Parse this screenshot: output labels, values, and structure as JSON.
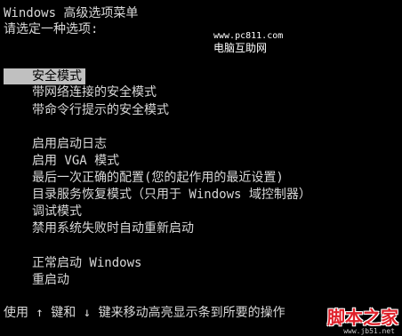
{
  "header": {
    "title": "Windows 高级选项菜单",
    "prompt": "请选定一种选项:"
  },
  "watermark": {
    "site": "www.pc811.com",
    "name": "电脑互助网"
  },
  "menu": {
    "selected_index": 0,
    "group1": [
      {
        "label": "安全模式"
      },
      {
        "label": "带网络连接的安全模式"
      },
      {
        "label": "带命令行提示的安全模式"
      }
    ],
    "group2": [
      {
        "label": "启用启动日志"
      },
      {
        "label": "启用 VGA 模式"
      },
      {
        "label": "最后一次正确的配置(您的起作用的最近设置)"
      },
      {
        "label": "目录服务恢复模式（只用于 Windows 域控制器）"
      },
      {
        "label": "调试模式"
      },
      {
        "label": "禁用系统失败时自动重新启动"
      }
    ],
    "group3": [
      {
        "label": "正常启动 Windows"
      },
      {
        "label": "重启动"
      }
    ]
  },
  "footer": {
    "instructions": "使用 ↑ 键和 ↓ 键来移动高亮显示条到所要的操作"
  },
  "corner_logo": {
    "text": "脚本之家",
    "url": "www.jb51.net"
  },
  "colors": {
    "background": "#000000",
    "text": "#d8d8d8",
    "highlight_bg": "#c0c0c0",
    "highlight_text": "#000000",
    "logo_red": "#e0202a"
  }
}
